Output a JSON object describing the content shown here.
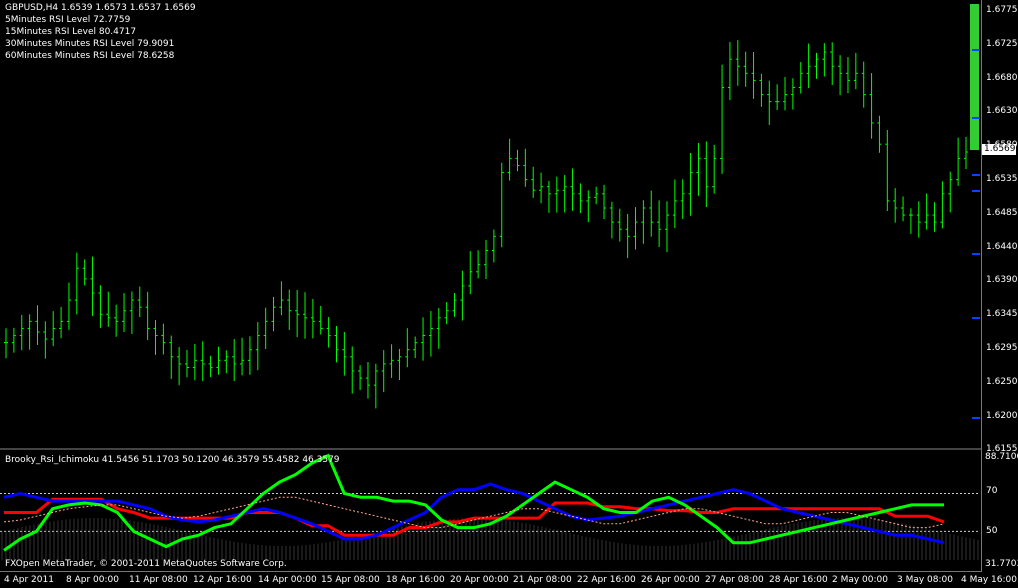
{
  "header": {
    "symbol_line": "GBPUSD,H4  1.6539 1.6573 1.6537 1.6569",
    "rsi_lines": [
      "5Minutes RSI Level 72.7759",
      "15Minutes RSI Level 80.4717",
      "30Minutes Minutes RSI Level 79.9091",
      "60Minutes Minutes RSI Level 78.6258"
    ]
  },
  "price_axis": {
    "ticks": [
      "1.6775",
      "1.6725",
      "1.6680",
      "1.6630",
      "1.6580",
      "1.6535",
      "1.6485",
      "1.6440",
      "1.6390",
      "1.6345",
      "1.6295",
      "1.6250",
      "1.6200",
      "1.6155"
    ],
    "current_price": "1.6569",
    "current_price_label": "1.6569"
  },
  "indicator": {
    "title": "Brooky_Rsi_Ichimoku 41.5456 51.1703 50.1200 46.3579 55.4582 46.3579",
    "axis_ticks": [
      "88.7106",
      "70",
      "50",
      "31.7703"
    ]
  },
  "time_axis": [
    "4 Apr 2011",
    "8 Apr 00:00",
    "11 Apr 08:00",
    "12 Apr 16:00",
    "14 Apr 00:00",
    "15 Apr 08:00",
    "18 Apr 16:00",
    "20 Apr 00:00",
    "21 Apr 08:00",
    "22 Apr 16:00",
    "26 Apr 00:00",
    "27 Apr 08:00",
    "28 Apr 16:00",
    "2 May 00:00",
    "3 May 08:00",
    "4 May 16:00"
  ],
  "footer": {
    "copyright": "FXOpen MetaTrader, © 2001-2011 MetaQuotes Software Corp."
  },
  "colors": {
    "candle": "#00ff00",
    "rsi_green": "#00ff00",
    "rsi_blue": "#0000ff",
    "rsi_red": "#ff0000",
    "cloud": "#ffaa88"
  },
  "price_series": [
    1.63,
    1.631,
    1.632,
    1.633,
    1.6315,
    1.6305,
    1.632,
    1.633,
    1.636,
    1.6405,
    1.639,
    1.637,
    1.634,
    1.6335,
    1.633,
    1.6345,
    1.636,
    1.635,
    1.632,
    1.631,
    1.63,
    1.628,
    1.627,
    1.6265,
    1.6275,
    1.627,
    1.6265,
    1.6275,
    1.628,
    1.627,
    1.6275,
    1.629,
    1.631,
    1.633,
    1.635,
    1.636,
    1.6345,
    1.634,
    1.6335,
    1.633,
    1.632,
    1.631,
    1.629,
    1.628,
    1.626,
    1.625,
    1.624,
    1.626,
    1.627,
    1.6275,
    1.628,
    1.629,
    1.63,
    1.631,
    1.632,
    1.6335,
    1.6345,
    1.636,
    1.638,
    1.64,
    1.641,
    1.643,
    1.645,
    1.654,
    1.656,
    1.655,
    1.653,
    1.6515,
    1.652,
    1.651,
    1.6515,
    1.652,
    1.651,
    1.65,
    1.6505,
    1.651,
    1.649,
    1.647,
    1.646,
    1.645,
    1.647,
    1.649,
    1.647,
    1.646,
    1.648,
    1.65,
    1.651,
    1.654,
    1.656,
    1.652,
    1.656,
    1.666,
    1.67,
    1.669,
    1.668,
    1.667,
    1.665,
    1.664,
    1.664,
    1.665,
    1.666,
    1.668,
    1.669,
    1.67,
    1.671,
    1.669,
    1.668,
    1.667,
    1.668,
    1.665,
    1.661,
    1.658,
    1.65,
    1.649,
    1.648,
    1.648,
    1.647,
    1.648,
    1.647,
    1.651,
    1.653,
    1.656,
    1.6569
  ]
}
